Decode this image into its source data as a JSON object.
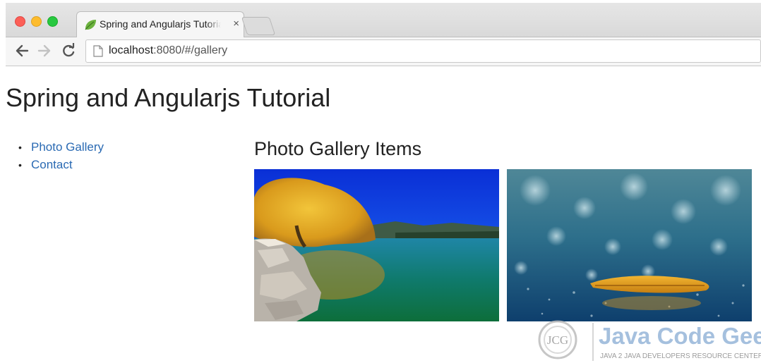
{
  "browser": {
    "tab_title": "Spring and Angularjs Tutorial",
    "tab_close": "×",
    "url_host": "localhost",
    "url_rest": ":8080/#/gallery"
  },
  "page": {
    "title": "Spring and Angularjs Tutorial",
    "nav": [
      {
        "label": "Photo Gallery",
        "bullet": "•"
      },
      {
        "label": "Contact",
        "bullet": "•"
      }
    ],
    "gallery_heading": "Photo Gallery Items"
  },
  "watermark": {
    "logo_letters": "JCG",
    "brand": "Java Code Geeks",
    "tagline": "JAVA 2 JAVA DEVELOPERS RESOURCE CENTER"
  },
  "colors": {
    "link": "#2a6ab3",
    "close_light": "#fc5f57",
    "minimize_light": "#fdbc2e",
    "zoom_light": "#28c840"
  },
  "icons": [
    "back-arrow-icon",
    "forward-arrow-icon",
    "reload-icon",
    "page-icon",
    "leaf-favicon"
  ]
}
